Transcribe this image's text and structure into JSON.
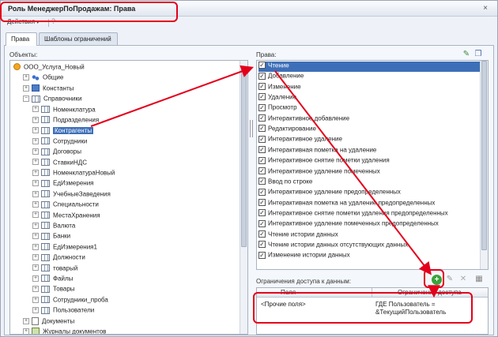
{
  "window": {
    "title": "Роль МенеджерПоПродажам: Права",
    "close_glyph": "×"
  },
  "menu": {
    "actions_label": "Действия",
    "caret": "▾",
    "help_glyph": "?"
  },
  "tabs": [
    {
      "label": "Права",
      "active": true
    },
    {
      "label": "Шаблоны ограничений",
      "active": false
    }
  ],
  "objects": {
    "label": "Объекты:",
    "root": "ООО_Услуга_Новый",
    "top_items": [
      {
        "label": "Общие",
        "icon": "common-icon"
      },
      {
        "label": "Константы",
        "icon": "constants-icon"
      },
      {
        "label": "Справочники",
        "icon": "catalogs-icon"
      }
    ],
    "catalogs": [
      "Номенклатура",
      "Подразделения",
      "Контрагенты",
      "Сотрудники",
      "Договоры",
      "СтавкиНДС",
      "НоменклатураНовый",
      "ЕдИзмерения",
      "УчебныеЗаведения",
      "Специальности",
      "МестаХранения",
      "Валюта",
      "Банки",
      "ЕдИзмерения1",
      "Должности",
      "товарый",
      "Файлы",
      "Товары",
      "Сотрудники_проба",
      "Пользователи"
    ],
    "selected": "Контрагенты",
    "bottom_items": [
      {
        "label": "Документы",
        "icon": "documents-icon"
      },
      {
        "label": "Журналы документов",
        "icon": "journals-icon"
      }
    ]
  },
  "rights": {
    "label": "Права:",
    "selected": "Чтение",
    "items": [
      "Чтение",
      "Добавление",
      "Изменение",
      "Удаление",
      "Просмотр",
      "Интерактивное добавление",
      "Редактирование",
      "Интерактивное удаление",
      "Интерактивная пометка на удаление",
      "Интерактивное снятие пометки удаления",
      "Интерактивное удаление помеченных",
      "Ввод по строке",
      "Интерактивное удаление предопределенных",
      "Интерактивная пометка на удаление предопределенных",
      "Интерактивное снятие пометки удаления предопределенных",
      "Интерактивное удаление помеченных предопределенных",
      "Чтение истории данных",
      "Чтение истории данных отсутствующих данных",
      "Изменение истории данных"
    ],
    "check_glyph": "✓"
  },
  "restrictions": {
    "label": "Ограничения доступа к данным:",
    "col_field": "Поля",
    "col_condition": "Ограничение доступа",
    "row_field": "<Прочие поля>",
    "row_condition_line1": "ГДЕ Пользователь =",
    "row_condition_line2": "&ТекущийПользователь",
    "add_glyph": "+",
    "edit_glyph": "✎",
    "delete_glyph": "✕"
  },
  "colors": {
    "annotation_red": "#e3001b",
    "selection_blue": "#3d6fb8",
    "add_green": "#3aa33a"
  }
}
